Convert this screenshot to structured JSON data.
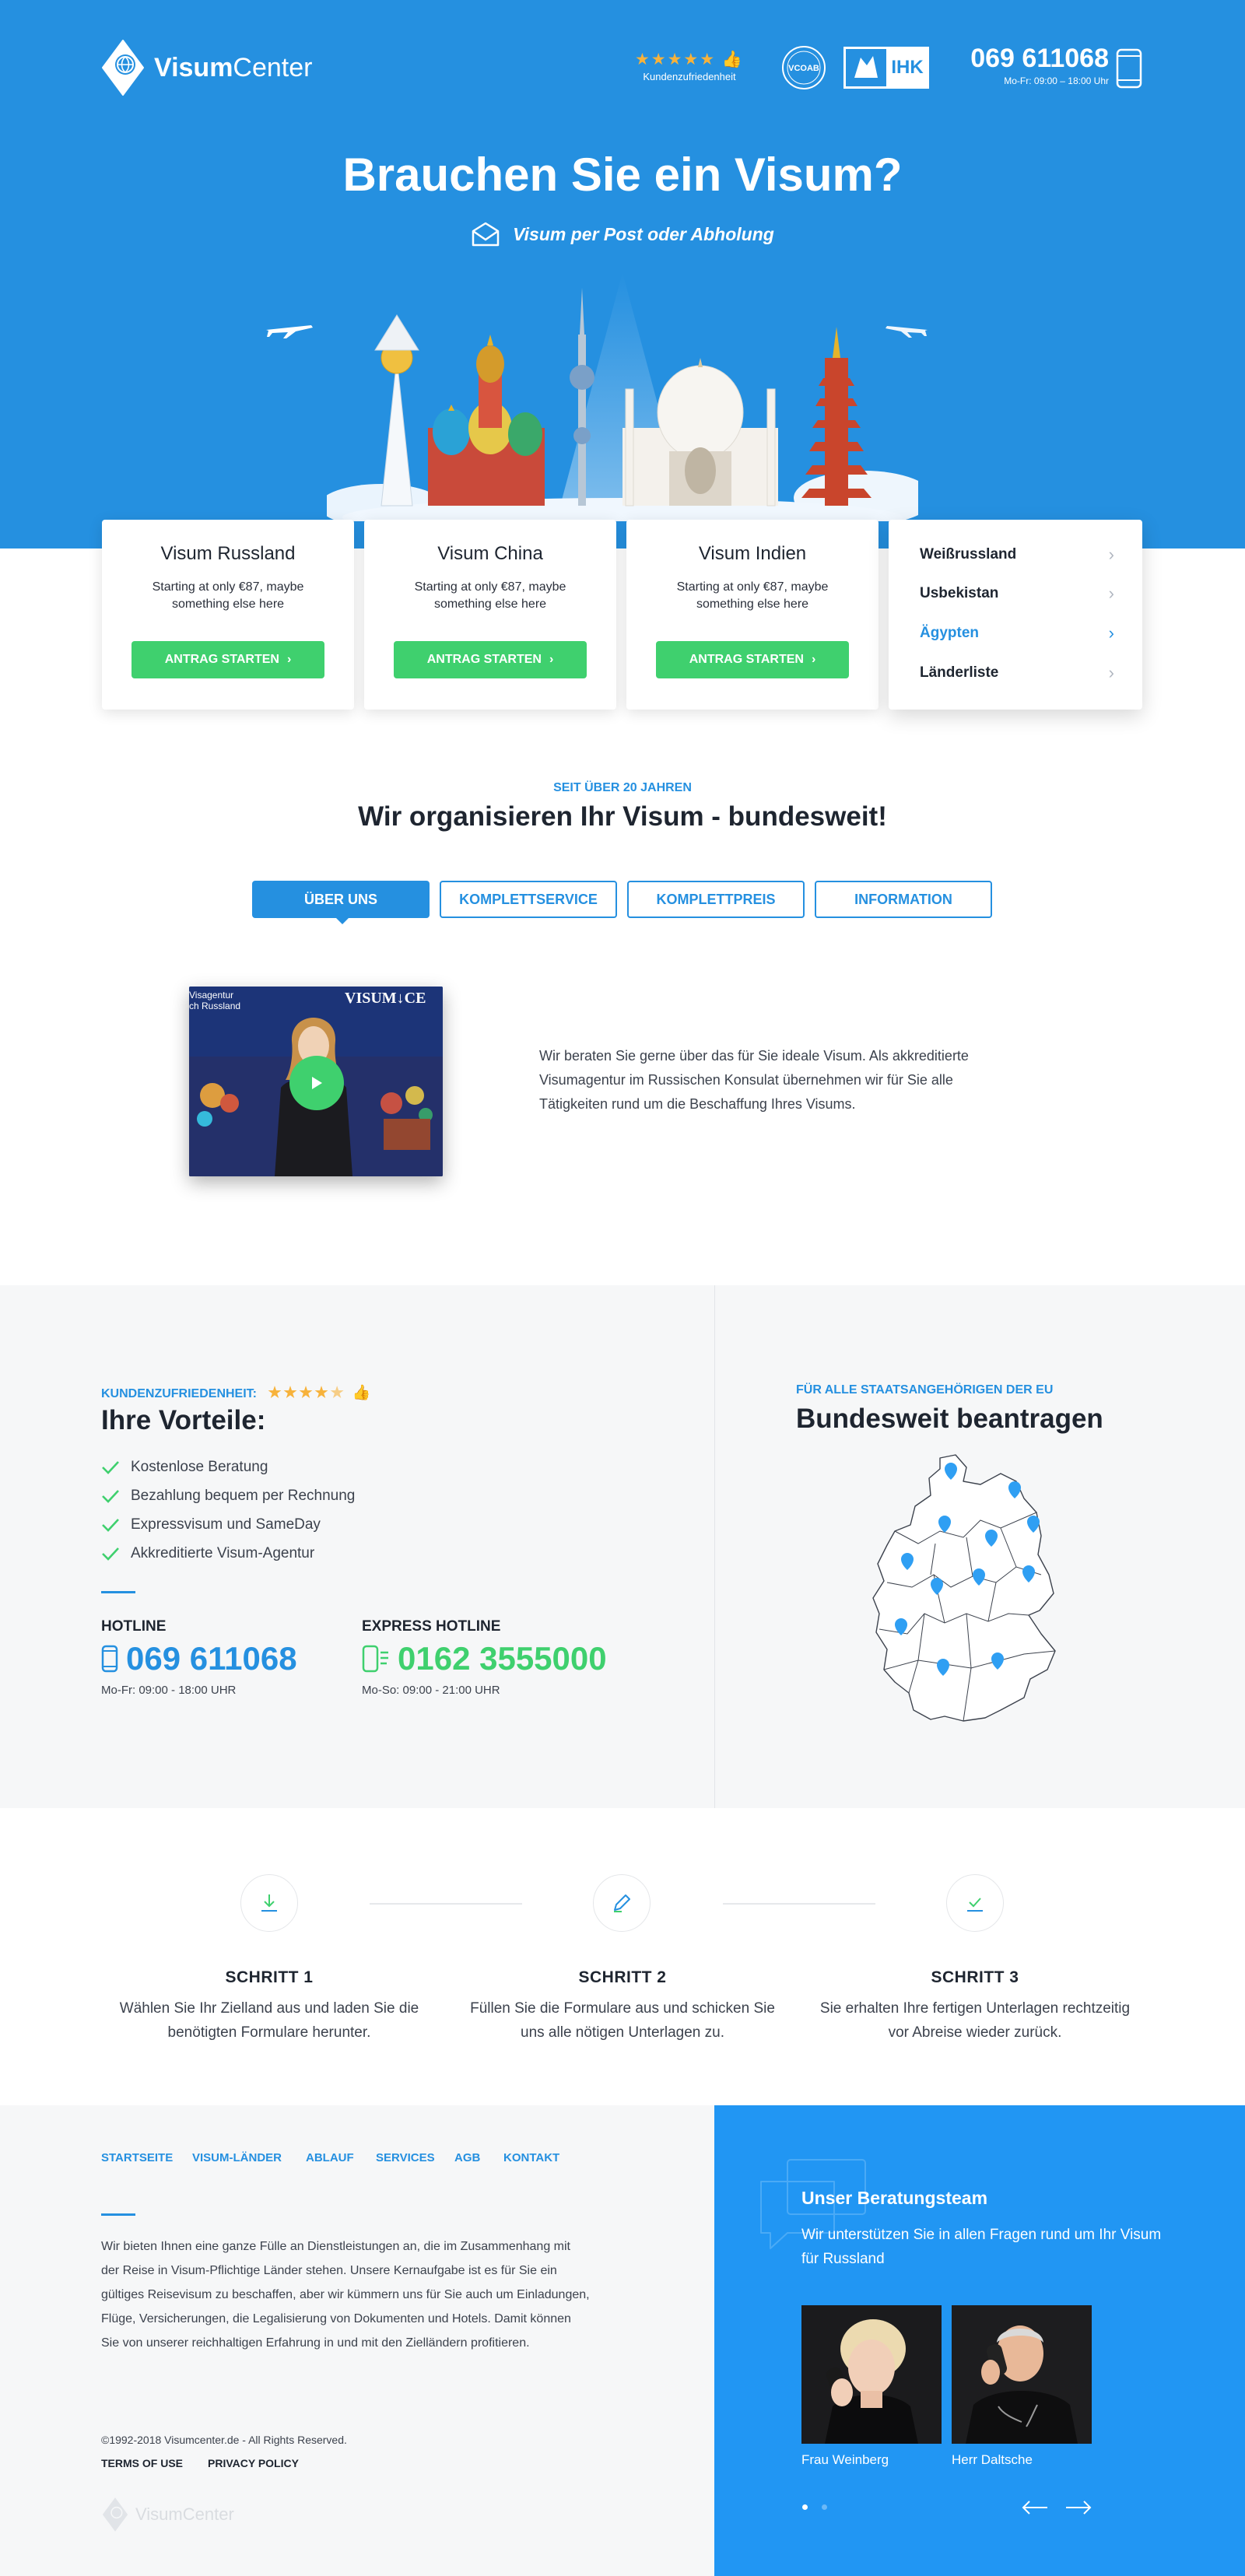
{
  "header": {
    "logo": {
      "bold": "Visum",
      "light": "Center"
    },
    "rating_label": "Kundenzufriedenheit",
    "badges": [
      "VCOAB",
      "IHK"
    ],
    "phone_number": "069 611068",
    "phone_hours": "Mo-Fr: 09:00 – 18:00 Uhr"
  },
  "hero": {
    "title": "Brauchen Sie ein Visum?",
    "subtitle": "Visum per Post oder Abholung"
  },
  "cards": [
    {
      "title": "Visum Russland",
      "text": "Starting at only €87, maybe something else here",
      "button": "ANTRAG STARTEN"
    },
    {
      "title": "Visum China",
      "text": "Starting at only €87, maybe something else here",
      "button": "ANTRAG STARTEN"
    },
    {
      "title": "Visum Indien",
      "text": "Starting at only €87, maybe something else here",
      "button": "ANTRAG STARTEN"
    }
  ],
  "country_list": [
    {
      "label": "Weißrussland",
      "active": false
    },
    {
      "label": "Usbekistan",
      "active": false
    },
    {
      "label": "Ägypten",
      "active": true
    },
    {
      "label": "Länderliste",
      "active": false
    }
  ],
  "about": {
    "eyebrow": "SEIT ÜBER 20 JAHREN",
    "title": "Wir organisieren Ihr Visum - bundesweit!",
    "tabs": [
      {
        "label": "ÜBER UNS",
        "active": true
      },
      {
        "label": "KOMPLETTSERVICE",
        "active": false
      },
      {
        "label": "KOMPLETTPREIS",
        "active": false
      },
      {
        "label": "INFORMATION",
        "active": false
      }
    ],
    "video_caption_top": "VISUM",
    "video_caption_right": "CE",
    "video_tag_1": "Visagentur",
    "video_tag_2": "ch Russland",
    "text": "Wir beraten Sie gerne über das für Sie ideale Visum. Als akkreditierte Visumagentur im Russischen Konsulat übernehmen wir für Sie alle Tätigkeiten rund um die Beschaffung Ihres Visums."
  },
  "advantages": {
    "eyebrow": "KUNDENZUFRIEDENHEIT:",
    "rating": 4.5,
    "title": "Ihre Vorteile:",
    "items": [
      "Kostenlose Beratung",
      "Bezahlung bequem per Rechnung",
      "Expressvisum und SameDay",
      "Akkreditierte Visum-Agentur"
    ],
    "hotline": {
      "label": "HOTLINE",
      "number": "069 611068",
      "hours": "Mo-Fr: 09:00 - 18:00 UHR"
    },
    "express": {
      "label": "EXPRESS HOTLINE",
      "number": "0162 3555000",
      "hours": "Mo-So: 09:00 - 21:00 UHR"
    }
  },
  "map": {
    "eyebrow": "FÜR ALLE STAATSANGEHÖRIGEN DER EU",
    "title": "Bundesweit beantragen"
  },
  "steps": [
    {
      "title": "SCHRITT 1",
      "text": "Wählen Sie Ihr Zielland aus und laden Sie die benötigten Formulare herunter.",
      "icon": "download-icon"
    },
    {
      "title": "SCHRITT 2",
      "text": "Füllen Sie die Formulare aus und schicken Sie uns alle nötigen Unterlagen zu.",
      "icon": "pencil-icon"
    },
    {
      "title": "SCHRITT 3",
      "text": "Sie erhalten Ihre fertigen Unterlagen rechtzeitig vor Abreise wieder zurück.",
      "icon": "checkmark-icon"
    }
  ],
  "footer": {
    "nav": [
      "STARTSEITE",
      "VISUM-LÄNDER",
      "ABLAUF",
      "SERVICES",
      "AGB",
      "KONTAKT"
    ],
    "text": "Wir bieten Ihnen eine ganze Fülle an Dienstleistungen an, die im Zusammenhang mit der Reise in Visum-Pflichtige Länder stehen. Unsere Kernaufgabe ist es für Sie ein gültiges Reisevisum zu beschaffen, aber wir kümmern uns für Sie auch um Einladungen, Flüge, Versicherungen, die Legalisierung von Dokumenten und Hotels. Damit können Sie von unserer reichhaltigen Erfahrung in und mit den Zielländern profitieren.",
    "copyright": "©1992-2018 Visumcenter.de - All Rights Reserved.",
    "links": [
      "TERMS OF USE",
      "PRIVACY POLICY"
    ]
  },
  "team": {
    "title": "Unser Beratungsteam",
    "subtitle": "Wir unterstützen Sie in allen Fragen rund um Ihr Visum für Russland",
    "members": [
      "Frau Weinberg",
      "Herr Daltsche"
    ]
  }
}
